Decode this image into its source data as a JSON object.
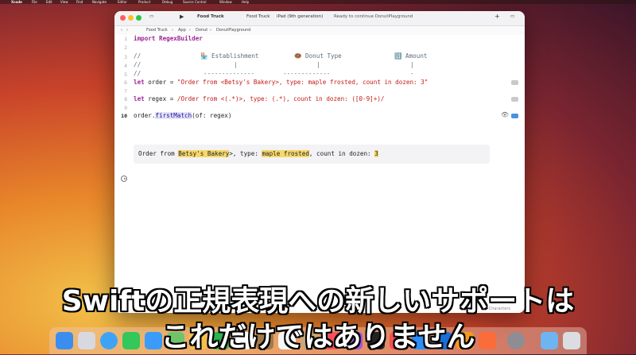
{
  "menubar": [
    "Xcode",
    "File",
    "Edit",
    "View",
    "Find",
    "Navigate",
    "Editor",
    "Product",
    "Debug",
    "Source Control",
    "Window",
    "Help"
  ],
  "toolbar": {
    "scheme": "Food Truck",
    "target": "Food Truck",
    "device": "iPad (9th generation)",
    "status": "Ready to continue DonutPlayground"
  },
  "breadcrumb": [
    "Food Truck",
    "App",
    "Donut",
    "DonutPlayground"
  ],
  "code_lines": {
    "l1": "import RegexBuilder",
    "l3a": "//",
    "l3b": "Establishment",
    "l3c": "Donut Type",
    "l3d": "Amount",
    "l4": "//",
    "l5": "//",
    "l6a": "let order = ",
    "l6b": "\"Order from <Betsy's Bakery>, type: maple frosted, count in dozen: 3\"",
    "l8a": "let regex = ",
    "l8b": "/Order from <(.*)>, type: (.*), count in dozen: ([0-9]+)/",
    "l10a": "order.",
    "l10b": "firstMatch",
    "l10c": "(of: regex)"
  },
  "line_numbers": [
    "1",
    "2",
    "3",
    "4",
    "5",
    "6",
    "7",
    "8",
    "9",
    "10"
  ],
  "result": {
    "prefix": "Order from ",
    "establishment": "Betsy's Bakery",
    "mid1": ">, type: ",
    "donut": "maple frosted",
    "mid2": ", count in dozen: ",
    "amount": "3"
  },
  "status_bar": "Characters",
  "subtitle": {
    "line1": "Swiftの正規表現への新しいサポートは",
    "line2": "これだけではありません"
  }
}
